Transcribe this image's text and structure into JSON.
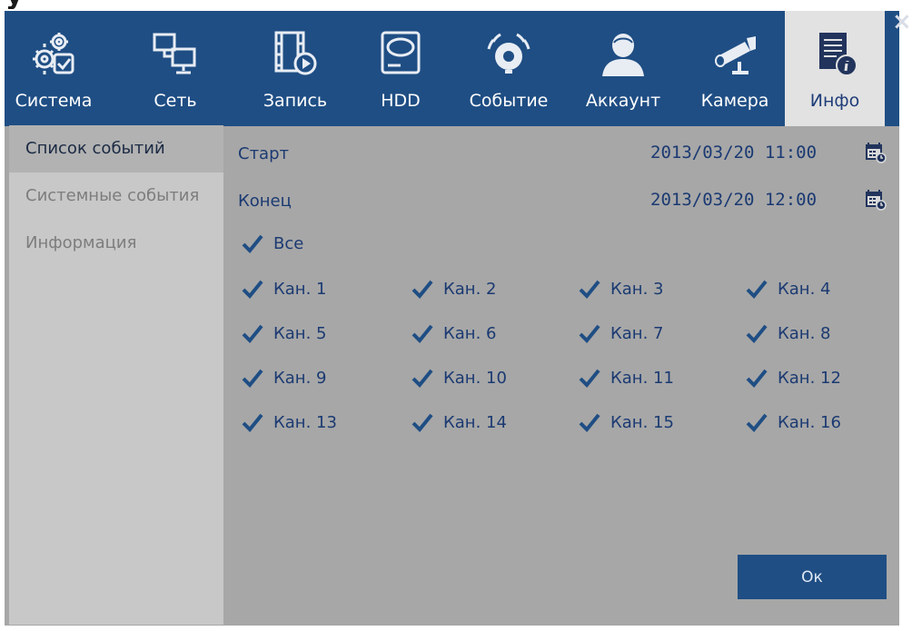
{
  "window": {
    "close_symbol": "×",
    "clipped_title_fragment": "y"
  },
  "colors": {
    "toolbar": "#1f4e84",
    "panel": "#a7a7a7",
    "sidebar": "#c8c8c8",
    "active_tab": "#e2e2e2",
    "text": "#1b3a72",
    "ok_button": "#1f4e84"
  },
  "toolbar": {
    "tabs": [
      {
        "label": "Система",
        "icon": "gears-check-icon",
        "active": false
      },
      {
        "label": "Сеть",
        "icon": "network-monitors-icon",
        "active": false
      },
      {
        "label": "Запись",
        "icon": "film-record-icon",
        "active": false
      },
      {
        "label": "HDD",
        "icon": "hard-drive-icon",
        "active": false
      },
      {
        "label": "Событие",
        "icon": "alarm-bell-icon",
        "active": false
      },
      {
        "label": "Аккаунт",
        "icon": "user-account-icon",
        "active": false
      },
      {
        "label": "Камера",
        "icon": "bullet-camera-icon",
        "active": false
      },
      {
        "label": "Инфо",
        "icon": "info-document-icon",
        "active": true
      }
    ]
  },
  "sidebar": {
    "items": [
      {
        "label": "Список событий",
        "active": true
      },
      {
        "label": "Системные события",
        "active": false
      },
      {
        "label": "Информация",
        "active": false
      }
    ]
  },
  "main": {
    "start_label": "Старт",
    "start_value": "2013/03/20 11:00",
    "end_label": "Конец",
    "end_value": "2013/03/20 12:00",
    "all": {
      "label": "Все",
      "checked": true
    },
    "channels": [
      {
        "label": "Кан. 1",
        "checked": true
      },
      {
        "label": "Кан. 2",
        "checked": true
      },
      {
        "label": "Кан. 3",
        "checked": true
      },
      {
        "label": "Кан. 4",
        "checked": true
      },
      {
        "label": "Кан. 5",
        "checked": true
      },
      {
        "label": "Кан. 6",
        "checked": true
      },
      {
        "label": "Кан. 7",
        "checked": true
      },
      {
        "label": "Кан. 8",
        "checked": true
      },
      {
        "label": "Кан. 9",
        "checked": true
      },
      {
        "label": "Кан. 10",
        "checked": true
      },
      {
        "label": "Кан. 11",
        "checked": true
      },
      {
        "label": "Кан. 12",
        "checked": true
      },
      {
        "label": "Кан. 13",
        "checked": true
      },
      {
        "label": "Кан. 14",
        "checked": true
      },
      {
        "label": "Кан. 15",
        "checked": true
      },
      {
        "label": "Кан. 16",
        "checked": true
      }
    ],
    "ok_label": "Ок"
  }
}
